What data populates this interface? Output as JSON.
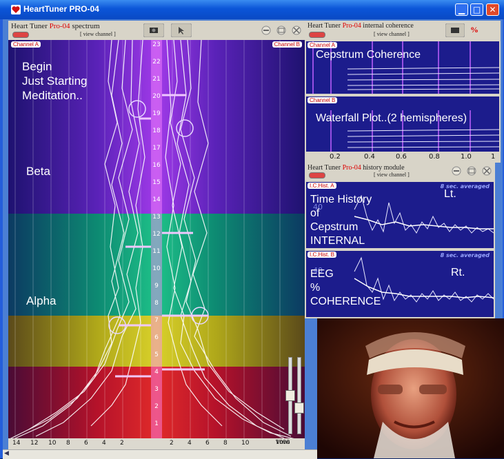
{
  "window": {
    "title": "HeartTuner PRO-04",
    "buttons": [
      "minimize",
      "maximize",
      "close"
    ]
  },
  "spectrum": {
    "header_prefix": "Heart Tuner",
    "header_brand": "Pro-04",
    "header_suffix": "spectrum",
    "view_channel": "[ view channel ]",
    "channel_a": "Channel A",
    "channel_b": "Channel B",
    "y_ticks": [
      "23",
      "22",
      "21",
      "20",
      "19",
      "18",
      "17",
      "16",
      "15",
      "14",
      "13",
      "12",
      "11",
      "10",
      "9",
      "8",
      "7",
      "6",
      "5",
      "4",
      "3",
      "2",
      "1"
    ],
    "x_ticks_left": [
      "14",
      "12",
      "10",
      "8",
      "6",
      "4",
      "2"
    ],
    "x_ticks_right": [
      "2",
      "4",
      "6",
      "8",
      "10"
    ],
    "x_unit": "Vrms",
    "x_unit_scale": "1000",
    "overlay": {
      "begin": "Begin",
      "starting": "Just Starting",
      "meditation": "Meditation..",
      "beta": "Beta",
      "alpha": "Alpha"
    },
    "band_colors": {
      "beta": "#7a2bd6",
      "alpha": "#0f9a7a",
      "theta": "#b9b21c",
      "delta": "#c8182e"
    }
  },
  "coherence": {
    "header_prefix": "Heart Tuner",
    "header_brand": "Pro-04",
    "header_suffix": "internal coherence",
    "view_channel": "[ view channel ]",
    "channel_a": "Channel A",
    "channel_b": "Channel B",
    "label_a": "Cepstrum Coherence",
    "label_b": "Waterfall Plot..(2 hemispheres)",
    "x_ticks": [
      "0.2",
      "0.4",
      "0.6",
      "0.8",
      "1.0",
      "1"
    ],
    "percent_icon": "%"
  },
  "history": {
    "header_prefix": "Heart Tuner",
    "header_brand": "Pro-04",
    "header_suffix": "history module",
    "view_channel": "[ view channel ]",
    "hist_a": "I.C.Hist. A",
    "hist_b": "I.C.Hist. B",
    "averaged": "8 sec. averaged",
    "y_tick_a": "40",
    "y_tick_b": "40",
    "text_a": [
      "Time History",
      "of",
      "Cepstrum",
      "INTERNAL"
    ],
    "text_b": [
      "EEG",
      "%",
      "COHERENCE"
    ],
    "left_label": "Lt.",
    "right_label": "Rt."
  }
}
